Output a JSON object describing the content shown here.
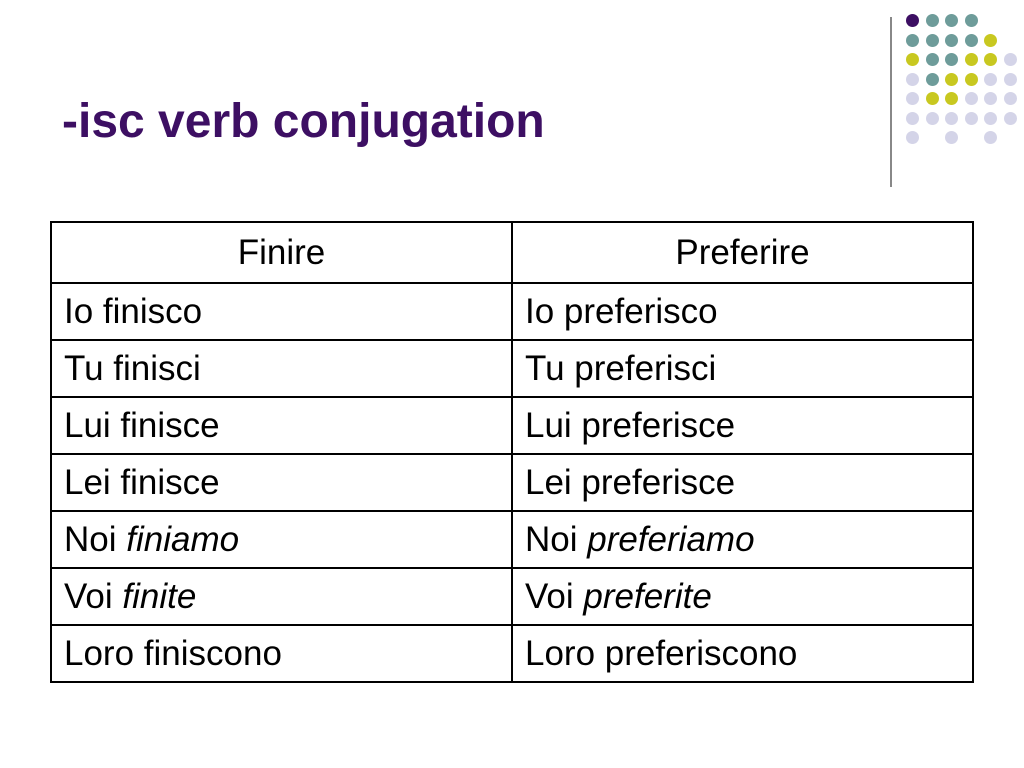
{
  "slide": {
    "title": "-isc verb conjugation"
  },
  "decoration": {
    "dot_palette": {
      "purple": "#3d0f63",
      "teal": "#6e9c9a",
      "olive": "#c8c820",
      "lavender": "#d4d4e8"
    },
    "dot_grid": [
      [
        0,
        1,
        1,
        1,
        null,
        null
      ],
      [
        1,
        1,
        1,
        1,
        2,
        null
      ],
      [
        2,
        1,
        1,
        2,
        2,
        3
      ],
      [
        3,
        1,
        2,
        2,
        3,
        4
      ],
      [
        4,
        2,
        2,
        4,
        4,
        4
      ],
      [
        5,
        3,
        3,
        4,
        4,
        4
      ],
      [
        6,
        null,
        4,
        null,
        4,
        null
      ]
    ],
    "dot_grid_colors": [
      "purple",
      "teal",
      "olive",
      "lavender"
    ]
  },
  "table": {
    "headers": [
      "Finire",
      "Preferire"
    ],
    "rows": [
      {
        "finire": {
          "pronoun": "Io finisco",
          "ending": ""
        },
        "preferire": {
          "pronoun": "Io preferisco",
          "ending": ""
        }
      },
      {
        "finire": {
          "pronoun": "Tu finisci",
          "ending": ""
        },
        "preferire": {
          "pronoun": "Tu preferisci",
          "ending": ""
        }
      },
      {
        "finire": {
          "pronoun": "Lui finisce",
          "ending": ""
        },
        "preferire": {
          "pronoun": "Lui preferisce",
          "ending": ""
        }
      },
      {
        "finire": {
          "pronoun": "Lei finisce",
          "ending": ""
        },
        "preferire": {
          "pronoun": "Lei preferisce",
          "ending": ""
        }
      },
      {
        "finire": {
          "pronoun": "Noi ",
          "ending": "finiamo"
        },
        "preferire": {
          "pronoun": "Noi ",
          "ending": "preferiamo"
        }
      },
      {
        "finire": {
          "pronoun": "Voi ",
          "ending": "finite"
        },
        "preferire": {
          "pronoun": "Voi ",
          "ending": "preferite"
        }
      },
      {
        "finire": {
          "pronoun": "Loro finiscono",
          "ending": ""
        },
        "preferire": {
          "pronoun": "Loro preferiscono",
          "ending": ""
        }
      }
    ]
  }
}
